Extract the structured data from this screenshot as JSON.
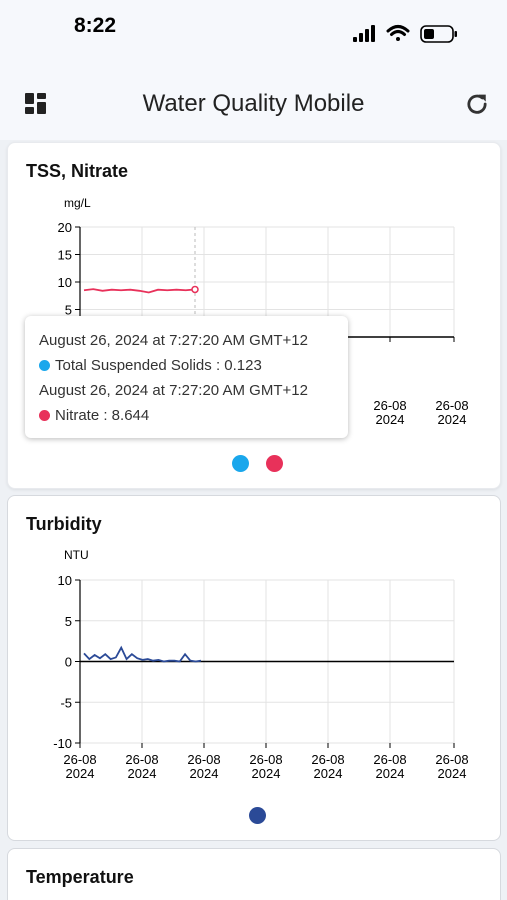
{
  "status_bar": {
    "time": "8:22"
  },
  "header": {
    "title": "Water Quality Mobile"
  },
  "colors": {
    "tss": "#1aa7ec",
    "nitrate": "#e8315a",
    "turbidity": "#2b4a97"
  },
  "cards": [
    {
      "title": "TSS, Nitrate",
      "unit": "mg/L"
    },
    {
      "title": "Turbidity",
      "unit": "NTU"
    },
    {
      "title": "Temperature"
    }
  ],
  "tooltip": {
    "row1_time": "August 26, 2024 at 7:27:20 AM GMT+12",
    "row1_value": "Total Suspended Solids : 0.123",
    "row2_time": "August 26, 2024 at 7:27:20 AM GMT+12",
    "row2_value": "Nitrate : 8.644"
  },
  "chart_data": [
    {
      "type": "line",
      "title": "TSS, Nitrate",
      "ylabel": "mg/L",
      "ylim": [
        0,
        20
      ],
      "y_ticks": [
        "20",
        "15",
        "10",
        "5"
      ],
      "x_tick_labels": [
        [
          "26-08",
          "2024"
        ],
        [
          "26-08",
          "2024"
        ]
      ],
      "grid": true,
      "series": [
        {
          "name": "Total Suspended Solids",
          "color": "#1aa7ec",
          "values": [
            0.1,
            0.1,
            0.12,
            0.1,
            0.1,
            0.12,
            0.11,
            0.1,
            0.12,
            0.11,
            0.1,
            0.12,
            0.123
          ]
        },
        {
          "name": "Nitrate",
          "color": "#e8315a",
          "values": [
            8.5,
            8.7,
            8.4,
            8.6,
            8.5,
            8.6,
            8.4,
            8.1,
            8.6,
            8.5,
            8.6,
            8.5,
            8.644
          ]
        }
      ]
    },
    {
      "type": "line",
      "title": "Turbidity",
      "ylabel": "NTU",
      "ylim": [
        -10,
        10
      ],
      "y_ticks": [
        "10",
        "5",
        "0",
        "-5",
        "-10"
      ],
      "x_tick_labels": [
        [
          "26-08",
          "2024"
        ],
        [
          "26-08",
          "2024"
        ],
        [
          "26-08",
          "2024"
        ],
        [
          "26-08",
          "2024"
        ],
        [
          "26-08",
          "2024"
        ],
        [
          "26-08",
          "2024"
        ],
        [
          "26-08",
          "2024"
        ]
      ],
      "grid": true,
      "series": [
        {
          "name": "Turbidity",
          "color": "#2b4a97",
          "values": [
            1.0,
            0.3,
            0.8,
            0.4,
            0.9,
            0.3,
            0.5,
            1.7,
            0.3,
            0.9,
            0.4,
            0.2,
            0.3,
            0.1,
            0.2,
            0.0,
            0.1,
            0.1,
            0.0,
            0.9,
            0.1,
            0.0,
            0.1
          ]
        }
      ]
    }
  ]
}
